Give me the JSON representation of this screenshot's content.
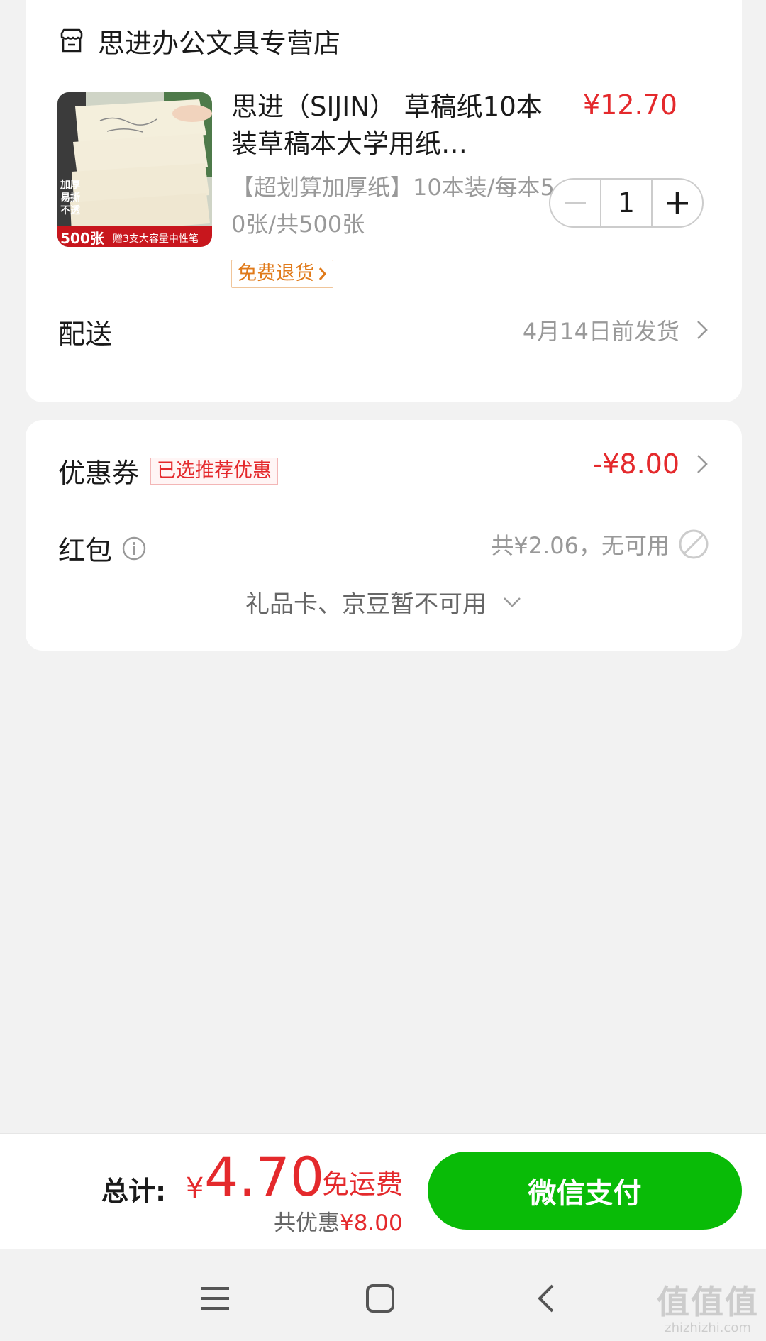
{
  "store": {
    "name": "思进办公文具专营店",
    "icon": "store-icon"
  },
  "product": {
    "title": "思进（SIJIN） 草稿纸10本装草稿本大学用纸…",
    "price": "¥12.70",
    "spec": "【超划算加厚纸】10本装/每本50张/共500张",
    "return_badge": "免费退货",
    "quantity": "1",
    "image_text": {
      "line1": "加厚",
      "line2": "易撕",
      "line3": "不透",
      "count": "500张",
      "promo": "赠3支大容量中性笔"
    }
  },
  "delivery": {
    "label": "配送",
    "value": "4月14日前发货"
  },
  "coupon": {
    "label": "优惠券",
    "badge": "已选推荐优惠",
    "amount": "-¥8.00"
  },
  "red_packet": {
    "label": "红包",
    "value": "共¥2.06，无可用"
  },
  "gift_card": {
    "label": "礼品卡、京豆暂不可用"
  },
  "footer": {
    "total_label": "总计:",
    "currency": "¥",
    "total_amount": "4.70",
    "free_shipping": "免运费",
    "saved_prefix": "共优惠",
    "saved_amount": "¥8.00",
    "pay_button": "微信支付"
  },
  "watermark": {
    "text": "值值值",
    "domain": "zhizhizhi.com"
  },
  "colors": {
    "price_red": "#e4292c",
    "pay_green": "#09bb07",
    "muted_gray": "#999999"
  }
}
